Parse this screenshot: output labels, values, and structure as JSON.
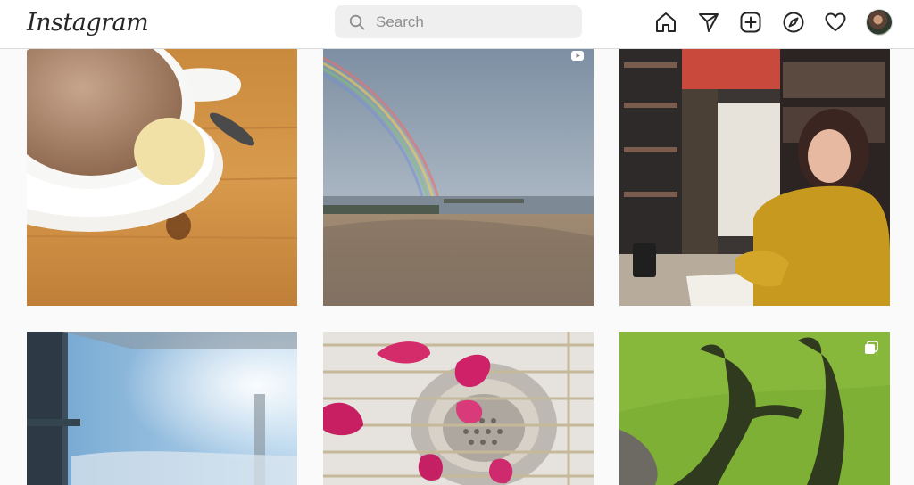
{
  "app": {
    "logo": "Instagram"
  },
  "search": {
    "placeholder": "Search"
  },
  "nav": {
    "icons": [
      "home-icon",
      "direct-message-icon",
      "new-post-icon",
      "explore-icon",
      "activity-heart-icon"
    ]
  },
  "grid": {
    "tiles": [
      {
        "id": "coffee-cup-photo"
      },
      {
        "id": "rainbow-beach-photo",
        "badge": "video-icon"
      },
      {
        "id": "bookstore-woman-photo"
      },
      {
        "id": "window-sky-photo"
      },
      {
        "id": "flower-petals-drain-photo"
      },
      {
        "id": "grass-shadow-photo",
        "badge": "carousel-icon"
      }
    ]
  }
}
